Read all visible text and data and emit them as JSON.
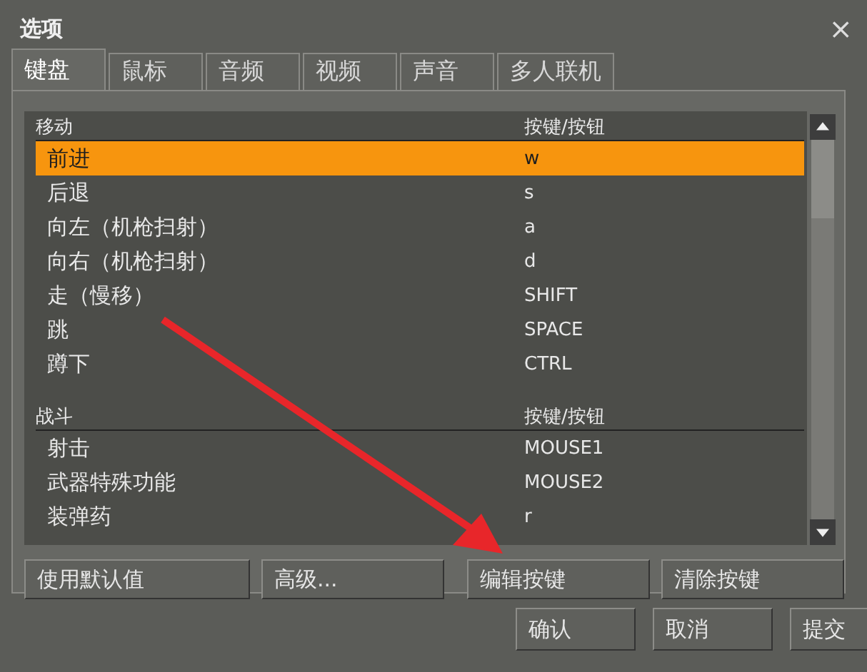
{
  "window": {
    "title": "选项",
    "close": "×"
  },
  "tabs": [
    {
      "label": "键盘",
      "selected": true
    },
    {
      "label": "鼠标",
      "selected": false
    },
    {
      "label": "音频",
      "selected": false
    },
    {
      "label": "视频",
      "selected": false
    },
    {
      "label": "声音",
      "selected": false
    },
    {
      "label": "多人联机",
      "selected": false
    }
  ],
  "sections": [
    {
      "title": "移动",
      "key_header": "按键/按钮",
      "rows": [
        {
          "action": "前进",
          "key": "w",
          "selected": true
        },
        {
          "action": "后退",
          "key": "s",
          "selected": false
        },
        {
          "action": "向左（机枪扫射）",
          "key": "a",
          "selected": false
        },
        {
          "action": "向右（机枪扫射）",
          "key": "d",
          "selected": false
        },
        {
          "action": "走（慢移）",
          "key": "SHIFT",
          "selected": false
        },
        {
          "action": "跳",
          "key": "SPACE",
          "selected": false
        },
        {
          "action": "蹲下",
          "key": "CTRL",
          "selected": false
        }
      ]
    },
    {
      "title": "战斗",
      "key_header": "按键/按钮",
      "rows": [
        {
          "action": "射击",
          "key": "MOUSE1",
          "selected": false
        },
        {
          "action": "武器特殊功能",
          "key": "MOUSE2",
          "selected": false
        },
        {
          "action": "装弹药",
          "key": "r",
          "selected": false
        }
      ]
    }
  ],
  "panel_buttons": [
    "使用默认值",
    "高级...",
    "编辑按键",
    "清除按键"
  ],
  "dialog_buttons": [
    "确认",
    "取消",
    "提交"
  ]
}
